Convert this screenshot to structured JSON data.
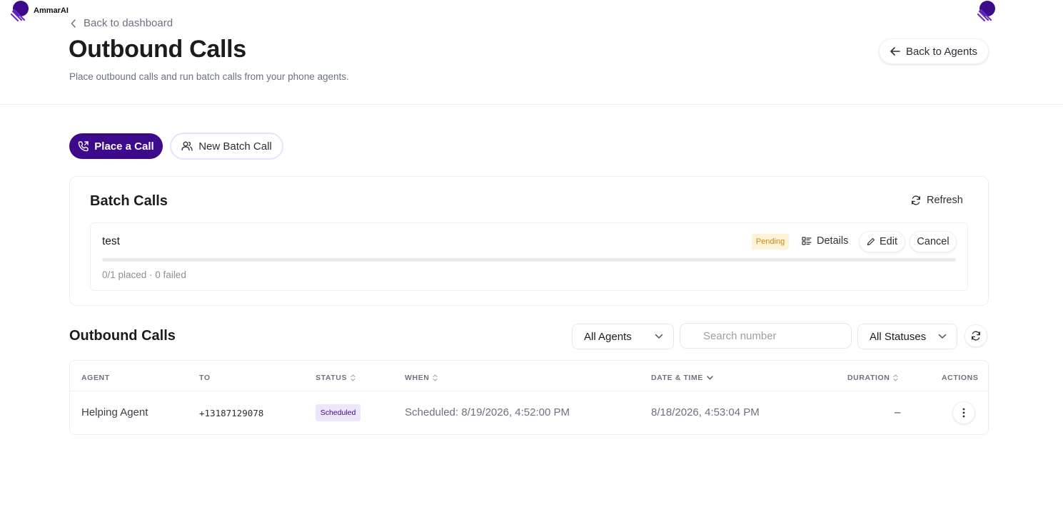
{
  "brand": {
    "name": "AmmarAI"
  },
  "header": {
    "back_link": "Back to dashboard",
    "title": "Outbound Calls",
    "subtitle": "Place outbound calls and run batch calls from your phone agents.",
    "back_agents": "Back to Agents"
  },
  "actions": {
    "place_call": "Place a Call",
    "new_batch": "New Batch Call"
  },
  "batch": {
    "title": "Batch Calls",
    "refresh": "Refresh",
    "items": [
      {
        "name": "test",
        "status": "Pending",
        "details": "Details",
        "edit": "Edit",
        "cancel": "Cancel",
        "progress": 0,
        "meta": "0/1 placed · 0 failed"
      }
    ]
  },
  "calls": {
    "title": "Outbound Calls",
    "agent_filter": "All Agents",
    "search_placeholder": "Search number",
    "status_filter": "All Statuses",
    "columns": {
      "agent": "AGENT",
      "to": "TO",
      "status": "STATUS",
      "when": "WHEN",
      "datetime": "DATE & TIME",
      "duration": "DURATION",
      "actions": "ACTIONS"
    },
    "rows": [
      {
        "agent": "Helping Agent",
        "to": "+13187129078",
        "status": "Scheduled",
        "when": "Scheduled: 8/19/2026, 4:52:00 PM",
        "datetime": "8/18/2026, 4:53:04 PM",
        "duration": "–"
      }
    ]
  },
  "colors": {
    "primary": "#3d0a8c",
    "pending_bg": "#fef3d6",
    "pending_text": "#c98a12",
    "scheduled_bg": "#ede5f8"
  }
}
